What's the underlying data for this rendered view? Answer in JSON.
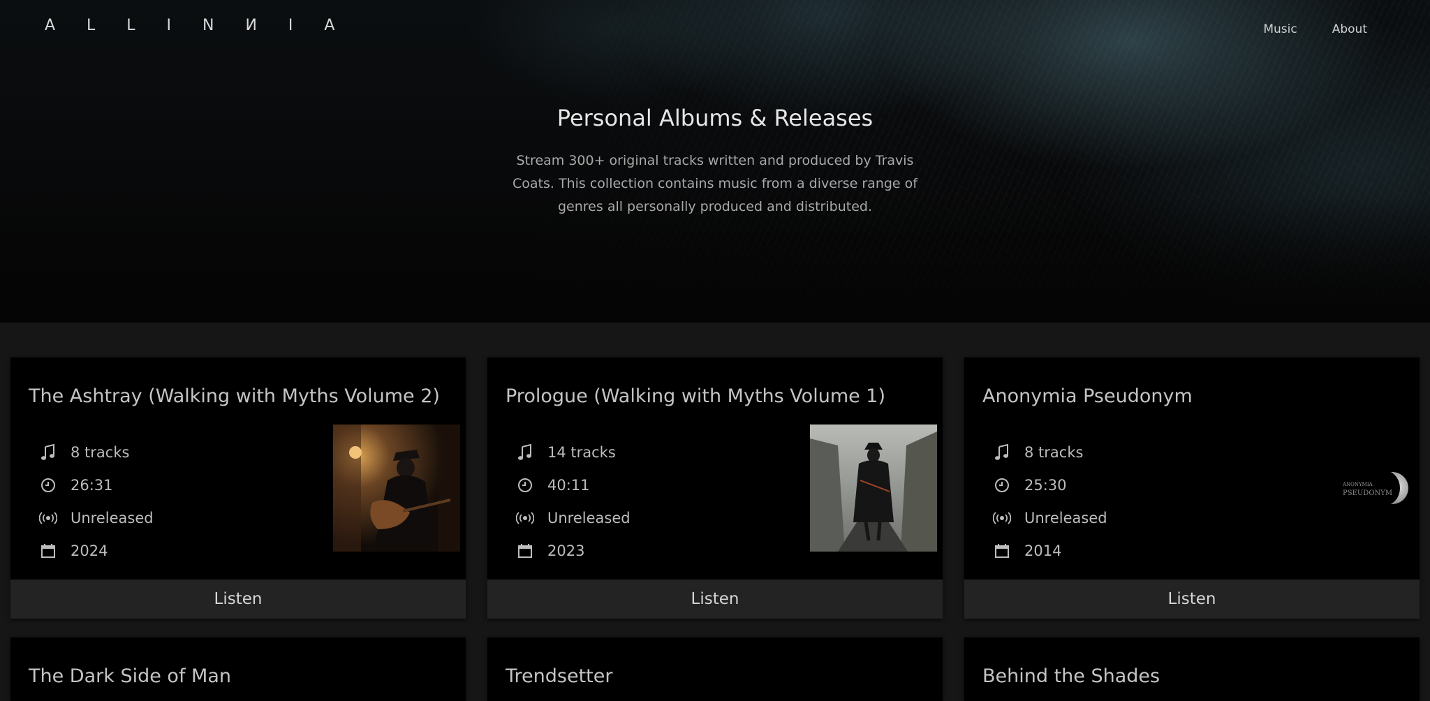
{
  "header": {
    "logo": "A L L I N И I A",
    "nav": [
      {
        "label": "Music"
      },
      {
        "label": "About"
      }
    ]
  },
  "hero": {
    "title": "Personal Albums & Releases",
    "description": "Stream 300+ original tracks written and produced by Travis Coats. This collection contains music from a diverse range of genres all personally produced and distributed."
  },
  "albums": [
    {
      "title": "The Ashtray (Walking with Myths Volume 2)",
      "tracks": "8 tracks",
      "duration": "26:31",
      "status": "Unreleased",
      "year": "2024",
      "button": "Listen"
    },
    {
      "title": "Prologue (Walking with Myths Volume 1)",
      "tracks": "14 tracks",
      "duration": "40:11",
      "status": "Unreleased",
      "year": "2023",
      "button": "Listen"
    },
    {
      "title": "Anonymia Pseudonym",
      "tracks": "8 tracks",
      "duration": "25:30",
      "status": "Unreleased",
      "year": "2014",
      "button": "Listen",
      "cover_text": [
        "ANONYMIA",
        "PSEUDONYM"
      ]
    },
    {
      "title": "The Dark Side of Man"
    },
    {
      "title": "Trendsetter"
    },
    {
      "title": "Behind the Shades"
    }
  ],
  "colors": {
    "page_bg": "#161616",
    "card_bg": "#000000",
    "button_bg": "#232323",
    "accent_teal": "#4a6c76"
  }
}
